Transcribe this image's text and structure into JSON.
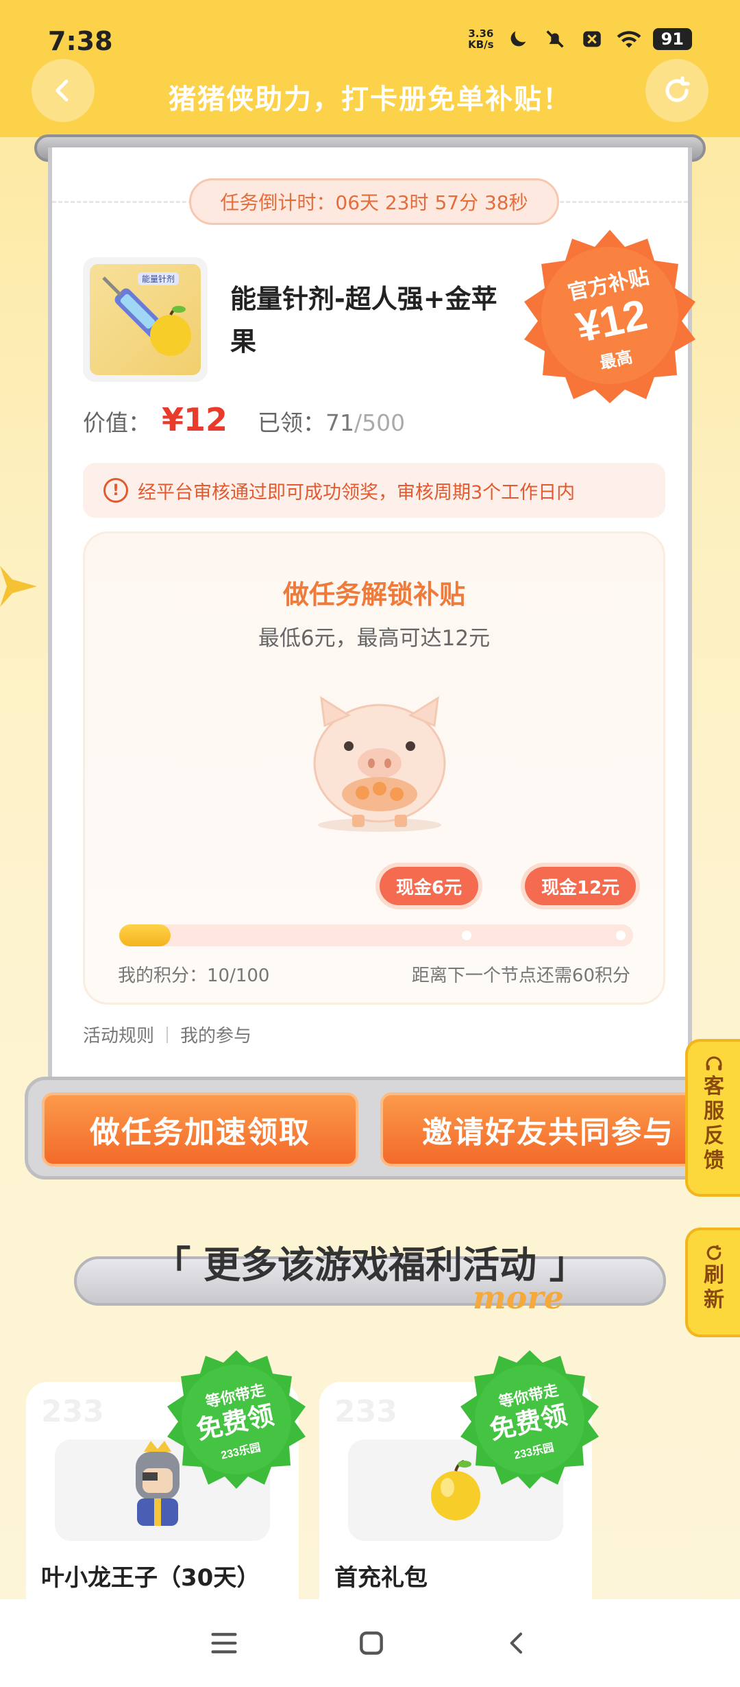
{
  "status_bar": {
    "time": "7:38",
    "net_speed_value": "3.36",
    "net_speed_unit": "KB/s",
    "battery": "91"
  },
  "header": {
    "title": "猪猪侠助力，打卡册免单补贴！"
  },
  "countdown": {
    "text": "任务倒计时：06天 23时 57分 38秒"
  },
  "product": {
    "name": "能量针剂-超人强+金苹果",
    "value_label": "价值：",
    "value": "¥12",
    "claimed_label": "已领：",
    "claimed": "71",
    "claimed_total": "/500",
    "image_label": "能量针剂"
  },
  "subsidy_badge": {
    "top_text": "官方补贴",
    "amount": "¥12",
    "bottom_text": "最高"
  },
  "notice": {
    "text": "经平台审核通过即可成功领奖，审核周期3个工作日内"
  },
  "task": {
    "title": "做任务解锁补贴",
    "subtitle": "最低6元，最高可达12元",
    "milestones": [
      "现金6元",
      "现金12元"
    ],
    "progress": 0.1,
    "points_text": "我的积分：10/100",
    "next_text": "距离下一个节点还需60积分"
  },
  "links": {
    "rules": "活动规则",
    "participation": "我的参与"
  },
  "actions": {
    "task_button": "做任务加速领取",
    "invite_button": "邀请好友共同参与"
  },
  "side_tabs": {
    "feedback": [
      "客",
      "服",
      "反",
      "馈"
    ],
    "refresh": [
      "刷",
      "新"
    ]
  },
  "more": {
    "title": "「 更多该游戏福利活动 」",
    "subtitle": "more"
  },
  "gifts": [
    {
      "name": "叶小龙王子（30天）",
      "badge_top": "等你带走",
      "badge_main": "免费领",
      "badge_bottom": "233乐园",
      "watermark": "233"
    },
    {
      "name": "首充礼包",
      "badge_top": "等你带走",
      "badge_main": "免费领",
      "badge_bottom": "233乐园",
      "watermark": "233"
    }
  ],
  "colors": {
    "header_bg": "#fcd24a",
    "accent_orange": "#f36a2a",
    "price_red": "#e83b2c",
    "badge_green": "#3dbb3a"
  }
}
